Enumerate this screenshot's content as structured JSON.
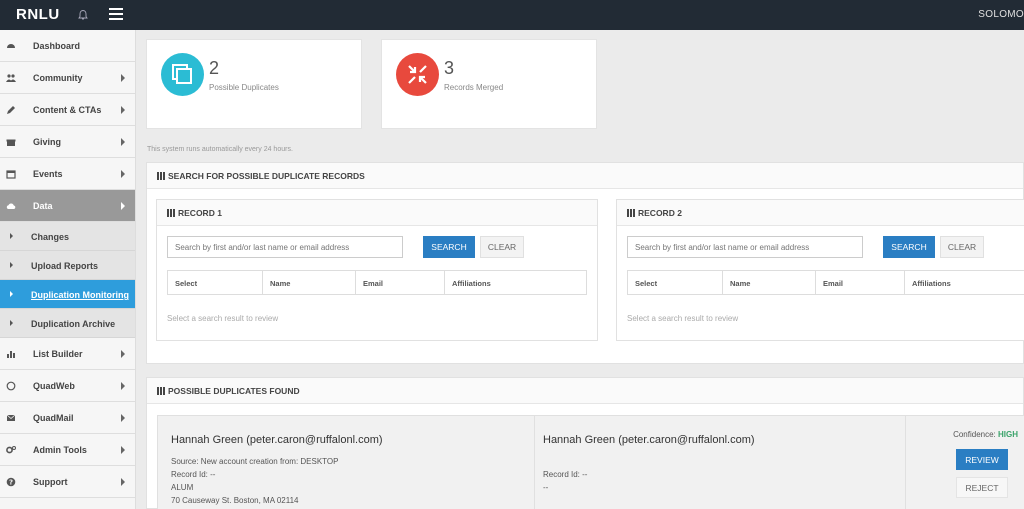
{
  "app": {
    "brand": "RNLU",
    "user_name": "SOLOMO"
  },
  "sidebar": {
    "items": [
      {
        "label": "Dashboard",
        "icon": "dashboard-icon"
      },
      {
        "label": "Community",
        "icon": "users-icon"
      },
      {
        "label": "Content & CTAs",
        "icon": "pencil-icon"
      },
      {
        "label": "Giving",
        "icon": "gift-icon"
      },
      {
        "label": "Events",
        "icon": "calendar-icon"
      },
      {
        "label": "Data",
        "icon": "cloud-icon"
      },
      {
        "label": "List Builder",
        "icon": "bar-chart-icon"
      },
      {
        "label": "QuadWeb",
        "icon": "circle-icon"
      },
      {
        "label": "QuadMail",
        "icon": "envelope-icon"
      },
      {
        "label": "Admin Tools",
        "icon": "cogs-icon"
      },
      {
        "label": "Support",
        "icon": "question-icon"
      }
    ],
    "data_sub": [
      {
        "label": "Changes"
      },
      {
        "label": "Upload Reports"
      },
      {
        "label": "Duplication Monitoring"
      },
      {
        "label": "Duplication Archive"
      }
    ]
  },
  "stats": [
    {
      "value": "2",
      "label": "Possible Duplicates",
      "color": "#2bbcd4"
    },
    {
      "value": "3",
      "label": "Records Merged",
      "color": "#e8493d"
    }
  ],
  "system_note": "This system runs automatically every 24 hours.",
  "search_panel": {
    "title": "SEARCH FOR POSSIBLE DUPLICATE RECORDS"
  },
  "records": [
    {
      "title": "RECORD 1",
      "placeholder": "Search by first and/or last name or email address",
      "search_label": "SEARCH",
      "clear_label": "CLEAR",
      "columns": [
        "Select",
        "Name",
        "Email",
        "Affiliations"
      ],
      "hint": "Select a search result to review"
    },
    {
      "title": "RECORD 2",
      "placeholder": "Search by first and/or last name or email address",
      "search_label": "SEARCH",
      "clear_label": "CLEAR",
      "columns": [
        "Select",
        "Name",
        "Email",
        "Affiliations"
      ],
      "hint": "Select a search result to review"
    }
  ],
  "duplicates": {
    "title": "POSSIBLE DUPLICATES FOUND",
    "left": {
      "name": "Hannah Green  (peter.caron@ruffalonl.com)",
      "source": "Source: New account creation from: DESKTOP",
      "record_id": "Record Id: --",
      "affiliation": "ALUM",
      "address": "70 Causeway St. Boston, MA 02114"
    },
    "right": {
      "name": "Hannah Green  (peter.caron@ruffalonl.com)",
      "record_id": "Record Id: --",
      "extra": "--"
    },
    "confidence_label": "Confidence:",
    "confidence_value": "HIGH",
    "review_label": "REVIEW",
    "reject_label": "REJECT"
  },
  "colors": {
    "topbar": "#222b35",
    "accent": "#2a7ec3",
    "active_nav": "#2e9ddc",
    "confidence_high": "#3aa36a"
  }
}
